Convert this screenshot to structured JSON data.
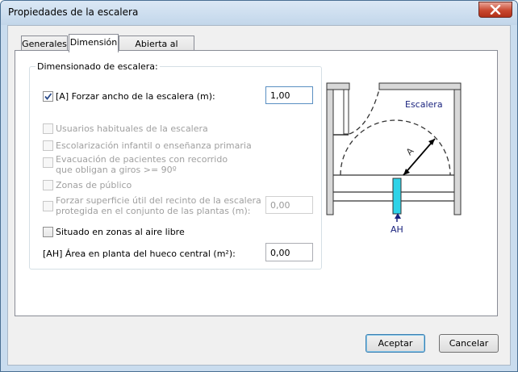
{
  "window": {
    "title": "Propiedades de la escalera"
  },
  "tabs": [
    {
      "label": "Generales"
    },
    {
      "label": "Dimensión"
    },
    {
      "label": "Abierta al exterior"
    }
  ],
  "group": {
    "title": "Dimensionado de escalera:"
  },
  "options": {
    "forzar_ancho": {
      "label": "[A] Forzar ancho de la escalera (m):",
      "checked": true,
      "value": "1,00"
    },
    "usuarios_habituales": {
      "label": "Usuarios habituales de la escalera"
    },
    "escolarizacion": {
      "label": "Escolarización infantil o enseñanza primaria"
    },
    "evacuacion": {
      "line1": "Evacuación de pacientes con recorrido",
      "line2": "que obligan a giros >= 90º"
    },
    "zonas_publico": {
      "label": "Zonas de público"
    },
    "forzar_superficie": {
      "line1": "Forzar superficie útil del recinto de la escalera",
      "line2": "protegida en el conjunto de las plantas (m):",
      "value": "0,00"
    },
    "situado_aire_libre": {
      "label": "Situado en zonas al aire libre",
      "checked": false
    },
    "area_hueco": {
      "label": "[AH] Área en planta del hueco central (m²):",
      "value": "0,00"
    }
  },
  "diagram": {
    "label_escalera": "Escalera",
    "label_a": "A",
    "label_ah": "AH"
  },
  "buttons": {
    "accept": "Aceptar",
    "cancel": "Cancelar"
  },
  "colors": {
    "diagram_label": "#1a237e",
    "hueco_fill": "#2fd3e8",
    "check_mark": "#2a4a8a"
  }
}
